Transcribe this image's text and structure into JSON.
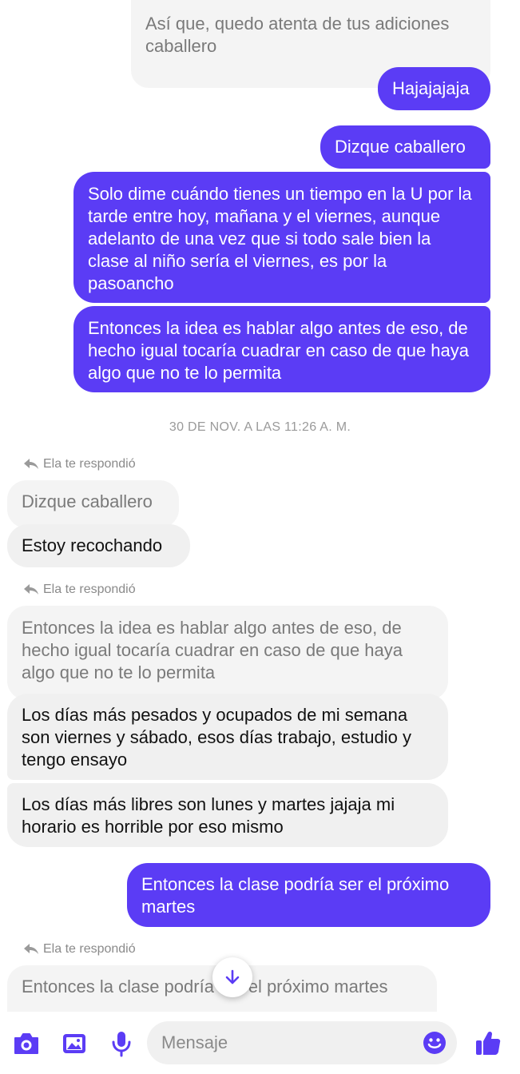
{
  "messages": {
    "m1": "Así que, quedo atenta de tus adiciones caballero",
    "m2": "Hajajajaja",
    "m3": "Dizque caballero",
    "m4": "Solo dime cuándo tienes un tiempo en la U por la tarde entre hoy, mañana y el viernes, aunque adelanto de una vez que si todo sale bien la clase al niño sería el viernes, es por la pasoancho",
    "m5": "Entonces la idea es hablar algo antes de eso, de hecho igual tocaría cuadrar en caso de que haya algo que no te lo permita",
    "timestamp": "30 DE NOV. A LAS 11:26 A. M.",
    "reply_label": "Ela te respondió",
    "r1_quote": "Dizque caballero",
    "r1_reply": "Estoy recochando",
    "r2_quote": "Entonces la idea es hablar algo antes de eso, de hecho igual tocaría cuadrar en caso de que haya algo que no te lo permita",
    "r2_reply1": "Los días más pesados y ocupados de mi semana son viernes y sábado, esos días trabajo, estudio y tengo ensayo",
    "r2_reply2": "Los días más libres son lunes y martes jajaja mi horario es horrible por eso mismo",
    "m6": "Entonces la clase podría ser el próximo martes",
    "r3_quote": "Entonces la clase podría ser el próximo martes"
  },
  "composer": {
    "placeholder": "Mensaje"
  },
  "icons": {
    "camera": "camera-icon",
    "gallery": "image-icon",
    "mic": "microphone-icon",
    "emoji": "emoji-icon",
    "like": "thumbs-up-icon",
    "scroll": "arrow-down-icon",
    "reply": "reply-icon"
  },
  "colors": {
    "accent": "#5b3cf5",
    "incoming": "#f0f0f0"
  }
}
